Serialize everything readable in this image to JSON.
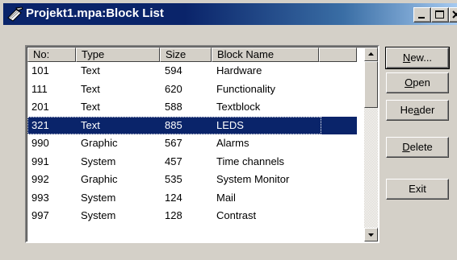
{
  "window": {
    "title": "Projekt1.mpa:Block List",
    "icon": "pencil-document-icon",
    "controls": [
      "minimize-icon",
      "maximize-icon",
      "close-icon"
    ]
  },
  "list": {
    "columns": [
      "No:",
      "Type",
      "Size",
      "Block Name"
    ],
    "rows": [
      {
        "no": "101",
        "type": "Text",
        "size": "594",
        "name": "Hardware",
        "selected": false
      },
      {
        "no": "111",
        "type": "Text",
        "size": "620",
        "name": "Functionality",
        "selected": false
      },
      {
        "no": "201",
        "type": "Text",
        "size": "588",
        "name": "Textblock",
        "selected": false
      },
      {
        "no": "321",
        "type": "Text",
        "size": "885",
        "name": "LEDS",
        "selected": true
      },
      {
        "no": "990",
        "type": "Graphic",
        "size": "567",
        "name": "Alarms",
        "selected": false
      },
      {
        "no": "991",
        "type": "System",
        "size": "457",
        "name": "Time channels",
        "selected": false
      },
      {
        "no": "992",
        "type": "Graphic",
        "size": "535",
        "name": "System Monitor",
        "selected": false
      },
      {
        "no": "993",
        "type": "System",
        "size": "124",
        "name": "Mail",
        "selected": false
      },
      {
        "no": "997",
        "type": "System",
        "size": "128",
        "name": "Contrast",
        "selected": false
      }
    ]
  },
  "buttons": {
    "new": {
      "pre": "",
      "key": "N",
      "post": "ew..."
    },
    "open": {
      "pre": "",
      "key": "O",
      "post": "pen"
    },
    "header": {
      "pre": "He",
      "key": "a",
      "post": "der"
    },
    "delete": {
      "pre": "",
      "key": "D",
      "post": "elete"
    },
    "exit": {
      "pre": "Exit",
      "key": "",
      "post": ""
    }
  },
  "colors": {
    "title_bar": "#0a246a",
    "selection": "#0a246a",
    "face": "#d4d0c8"
  }
}
